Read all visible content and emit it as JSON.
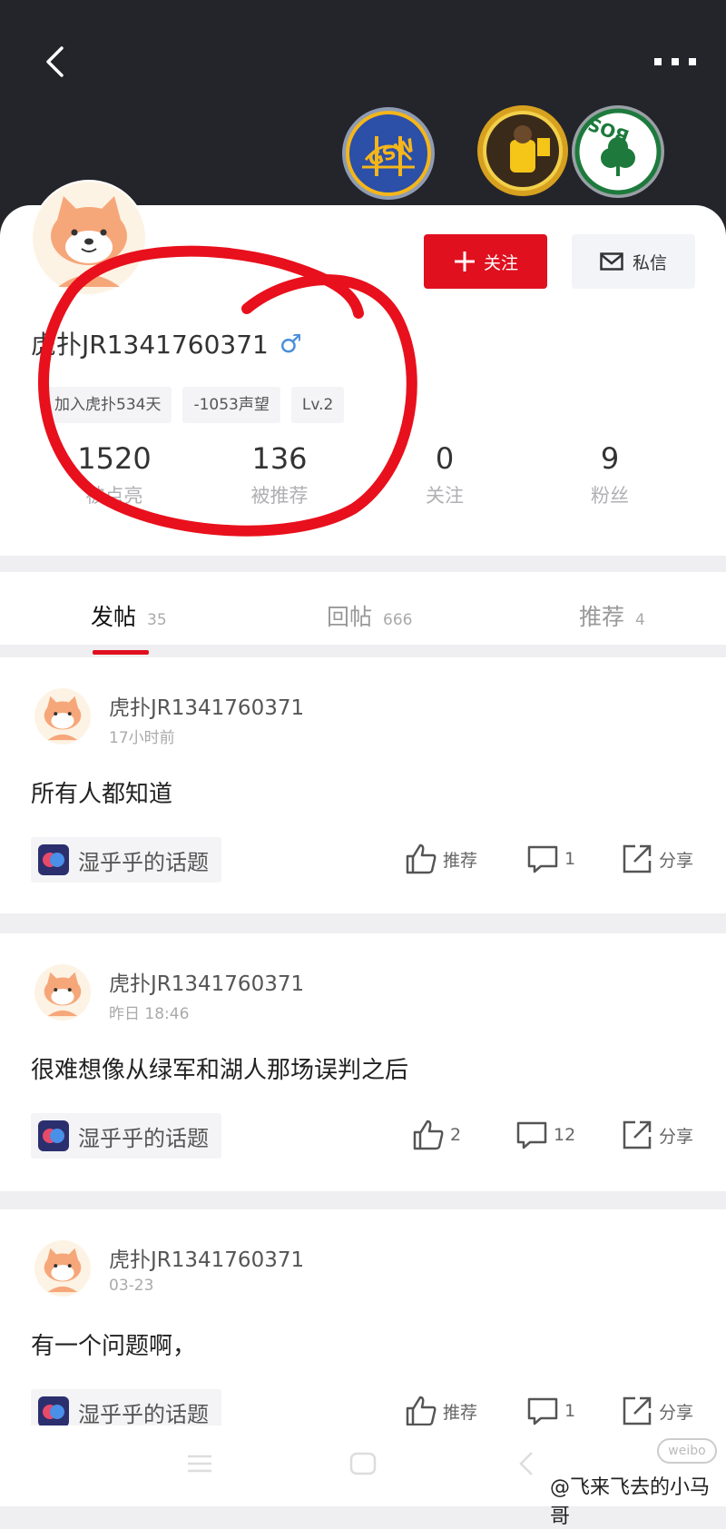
{
  "header": {
    "back_icon": "chevron-left-icon",
    "more_icon": "more-dots-icon",
    "badges": [
      {
        "name": "gsw-badge",
        "text": "GSW",
        "color": "#2c4fa8",
        "accent": "#f5b619"
      },
      {
        "name": "player-badge",
        "color": "#d7a11f"
      },
      {
        "name": "bos-badge",
        "text": "BOS",
        "color": "#1d7a3c"
      }
    ]
  },
  "profile": {
    "username": "虎扑JR1341760371",
    "gender_symbol": "♂",
    "follow_label": "关注",
    "message_label": "私信",
    "tags": [
      "加入虎扑534天",
      "-1053声望",
      "Lv.2"
    ],
    "stats": [
      {
        "value": "1520",
        "label": "被点亮"
      },
      {
        "value": "136",
        "label": "被推荐"
      },
      {
        "value": "0",
        "label": "关注"
      },
      {
        "value": "9",
        "label": "粉丝"
      }
    ]
  },
  "tabs": [
    {
      "label": "发帖",
      "count": "35",
      "active": true
    },
    {
      "label": "回帖",
      "count": "666",
      "active": false
    },
    {
      "label": "推荐",
      "count": "4",
      "active": false
    }
  ],
  "posts": [
    {
      "author": "虎扑JR1341760371",
      "time": "17小时前",
      "text": "所有人都知道",
      "topic": "湿乎乎的话题",
      "like": "推荐",
      "comments": "1",
      "share": "分享"
    },
    {
      "author": "虎扑JR1341760371",
      "time": "昨日 18:46",
      "text": "很难想像从绿军和湖人那场误判之后",
      "topic": "湿乎乎的话题",
      "like": "2",
      "comments": "12",
      "share": "分享"
    },
    {
      "author": "虎扑JR1341760371",
      "time": "03-23",
      "text": "有一个问题啊，",
      "topic": "湿乎乎的话题",
      "like": "推荐",
      "comments": "1",
      "share": "分享"
    }
  ],
  "watermark": {
    "text": "@飞来飞去的小马哥",
    "logo": "weibo"
  },
  "colors": {
    "accent": "#e0101f",
    "header_bg": "#23252b",
    "annotation": "#e8101c"
  }
}
